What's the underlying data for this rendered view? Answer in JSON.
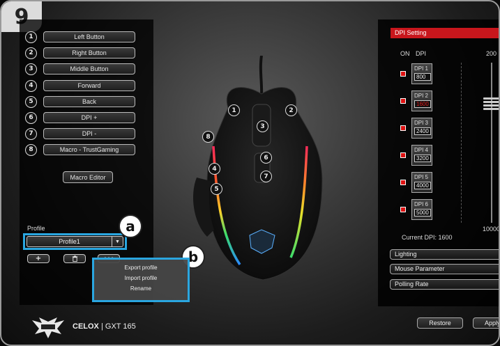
{
  "step_number": "9",
  "button_assignments": [
    {
      "num": "1",
      "label": "Left Button"
    },
    {
      "num": "2",
      "label": "Right Button"
    },
    {
      "num": "3",
      "label": "Middle Button"
    },
    {
      "num": "4",
      "label": "Forward"
    },
    {
      "num": "5",
      "label": "Back"
    },
    {
      "num": "6",
      "label": "DPI +"
    },
    {
      "num": "7",
      "label": "DPI -"
    },
    {
      "num": "8",
      "label": "Macro - TrustGaming"
    }
  ],
  "macro_editor_label": "Macro Editor",
  "profile": {
    "label": "Profile",
    "selected": "Profile1",
    "add_symbol": "+",
    "delete_symbol": "🗑",
    "more_symbol": "•••"
  },
  "callouts": {
    "a": "a",
    "b": "b"
  },
  "context_menu": [
    "Export profile",
    "Import profile",
    "Rename"
  ],
  "mouse_markers": [
    "1",
    "2",
    "3",
    "4",
    "5",
    "6",
    "7",
    "8"
  ],
  "dpi_panel": {
    "header": "DPI Setting",
    "col_on": "ON",
    "col_dpi": "DPI",
    "slider_max": "200",
    "slider_min": "10000",
    "levels": [
      {
        "label": "DPI 1",
        "value": "800",
        "enabled": true,
        "active": false
      },
      {
        "label": "DPI 2",
        "value": "1600",
        "enabled": true,
        "active": true
      },
      {
        "label": "DPI 3",
        "value": "2400",
        "enabled": true,
        "active": false
      },
      {
        "label": "DPI 4",
        "value": "3200",
        "enabled": true,
        "active": false
      },
      {
        "label": "DPI 5",
        "value": "4000",
        "enabled": true,
        "active": false
      },
      {
        "label": "DPI 6",
        "value": "5000",
        "enabled": true,
        "active": false
      }
    ],
    "current_dpi": "Current DPI: 1600"
  },
  "sections": [
    "Lighting",
    "Mouse Parameter",
    "Polling Rate"
  ],
  "footer": {
    "restore": "Restore",
    "apply": "Apply"
  },
  "brand": {
    "name": "CELOX",
    "sep": " | ",
    "model": "GXT 165"
  },
  "colors": {
    "accent_red": "#c8161c",
    "highlight_blue": "#2aa6e0"
  }
}
